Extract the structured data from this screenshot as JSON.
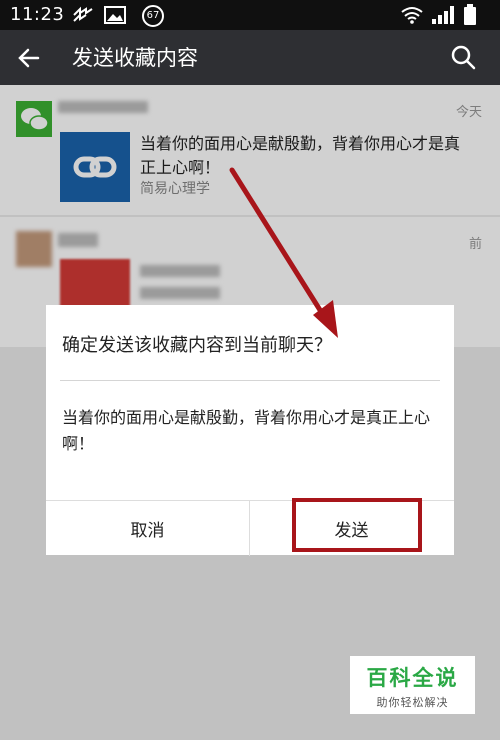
{
  "status_bar": {
    "time": "11:23",
    "notification_badge": "67"
  },
  "header": {
    "title": "发送收藏内容"
  },
  "items": [
    {
      "date": "今天",
      "link_text": "当着你的面用心是献殷勤，背着你用心才是真正上心啊！",
      "source": "简易心理学"
    },
    {
      "date": "前"
    }
  ],
  "dialog": {
    "title": "确定发送该收藏内容到当前聊天？",
    "body": "当着你的面用心是献殷勤，背着你用心才是真正上心啊！",
    "cancel_label": "取消",
    "send_label": "发送"
  },
  "watermark": {
    "title": "百科全说",
    "subtitle": "助你轻松解决"
  },
  "colors": {
    "header_bg": "#2e2f33",
    "link_thumb": "#1a63ad",
    "highlight": "#a8151a",
    "watermark_green": "#2aa845"
  }
}
